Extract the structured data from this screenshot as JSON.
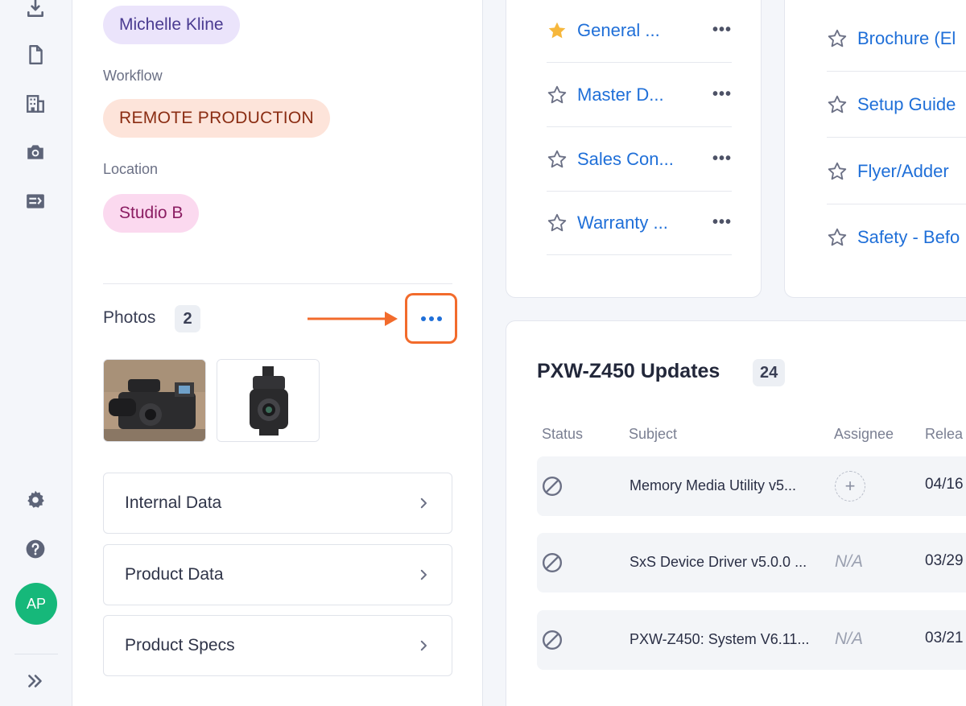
{
  "nav": {
    "avatar_initials": "AP",
    "icons": [
      "download-icon",
      "document-icon",
      "building-icon",
      "camera-icon",
      "form-icon",
      "gear-icon",
      "help-icon",
      "expand-icon"
    ]
  },
  "details": {
    "owner": "Michelle Kline",
    "workflow_label": "Workflow",
    "workflow": "REMOTE PRODUCTION",
    "location_label": "Location",
    "location": "Studio B",
    "photos_label": "Photos",
    "photos_count": "2",
    "sections": [
      {
        "label": "Internal Data"
      },
      {
        "label": "Product Data"
      },
      {
        "label": "Product Specs"
      }
    ]
  },
  "documents": [
    {
      "name": "General ...",
      "starred": true
    },
    {
      "name": "Master D...",
      "starred": false
    },
    {
      "name": "Sales Con...",
      "starred": false
    },
    {
      "name": "Warranty ...",
      "starred": false
    }
  ],
  "documents2": [
    {
      "name": "Brochure (El"
    },
    {
      "name": "Setup Guide"
    },
    {
      "name": "Flyer/Adder"
    },
    {
      "name": "Safety - Befo"
    }
  ],
  "updates": {
    "title": "PXW-Z450 Updates",
    "count": "24",
    "columns": [
      "Status",
      "Subject",
      "Assignee",
      "Relea"
    ],
    "rows": [
      {
        "subject": "Memory Media Utility v5...",
        "assignee": "",
        "date": "04/16"
      },
      {
        "subject": "SxS Device Driver v5.0.0 ...",
        "assignee": "N/A",
        "date": "03/29"
      },
      {
        "subject": "PXW-Z450: System V6.11...",
        "assignee": "N/A",
        "date": "03/21"
      }
    ]
  },
  "colors": {
    "accent": "#1f6fd8",
    "highlight": "#f26b2c",
    "avatar": "#16b87a"
  }
}
